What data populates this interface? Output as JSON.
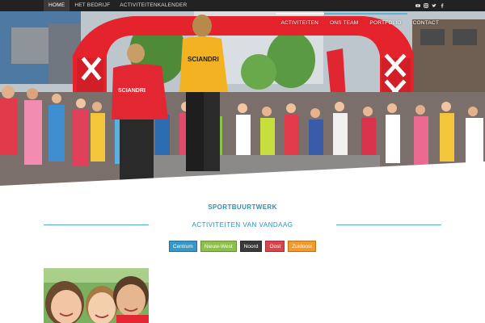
{
  "topbar": {
    "nav": [
      "HOME",
      "HET BEDRIJF",
      "ACTIVITEITENKALENDER"
    ],
    "active_index": 0,
    "social_icons": [
      "youtube-icon",
      "instagram-icon",
      "twitter-icon",
      "facebook-icon"
    ]
  },
  "main_nav": [
    "ACTIVITEITEN",
    "ONS TEAM",
    "PORTFOLIO",
    "CONTACT"
  ],
  "hero": {
    "shirt_text": "SCIANDRI",
    "colors": {
      "arch": "#e5232c",
      "shirt_front": "#e22733",
      "shirt_back": "#f3b222"
    }
  },
  "content": {
    "section_title": "SPORTBUURTWERK",
    "subtitle": "ACTIVITEITEN VAN VANDAAG",
    "accent": "#2f8fb4",
    "filters": [
      {
        "label": "Centrum",
        "color": "#3498c9"
      },
      {
        "label": "Nieuw-West",
        "color": "#8cc04b"
      },
      {
        "label": "Noord",
        "color": "#3a3a3a"
      },
      {
        "label": "Oost",
        "color": "#d9434a"
      },
      {
        "label": "Zuidoost",
        "color": "#f39a2b"
      }
    ]
  }
}
